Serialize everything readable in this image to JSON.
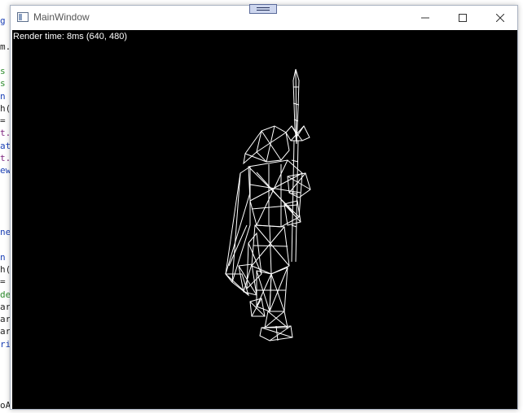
{
  "background_code": {
    "lines": [
      {
        "text": "g",
        "color": "#1a3fb5"
      },
      {
        "text": "m.",
        "color": "#222222"
      },
      {
        "text": "s",
        "color": "#2b8a2b"
      },
      {
        "text": "s",
        "color": "#2b8a2b"
      },
      {
        "text": "n",
        "color": "#1a3fb5"
      },
      {
        "text": "h(",
        "color": "#222222"
      },
      {
        "text": " =",
        "color": "#222222"
      },
      {
        "text": "t.",
        "color": "#7a1f7a"
      },
      {
        "text": "at",
        "color": "#1a3fb5"
      },
      {
        "text": "t.",
        "color": "#7a1f7a"
      },
      {
        "text": "ew",
        "color": "#1a3fb5"
      },
      {
        "text": "ne",
        "color": "#1a3fb5"
      },
      {
        "text": "n",
        "color": "#1a3fb5"
      },
      {
        "text": "h(",
        "color": "#222222"
      },
      {
        "text": " =",
        "color": "#222222"
      },
      {
        "text": "de",
        "color": "#2b8a2b"
      },
      {
        "text": "ar",
        "color": "#222222"
      },
      {
        "text": "ar",
        "color": "#222222"
      },
      {
        "text": "ar",
        "color": "#222222"
      },
      {
        "text": "ri",
        "color": "#1a3fb5"
      }
    ],
    "bottom_line": "oArray());"
  },
  "window": {
    "title": "MainWindow",
    "icon": "app-window-icon",
    "controls": {
      "minimize_icon": "minimize-icon",
      "maximize_icon": "maximize-icon",
      "close_icon": "close-icon"
    }
  },
  "viewport": {
    "render_time": "Render time: 8ms (640, 480)",
    "background_color": "#000000",
    "wire_color": "#ffffff",
    "content": "wireframe-warrior-model"
  }
}
